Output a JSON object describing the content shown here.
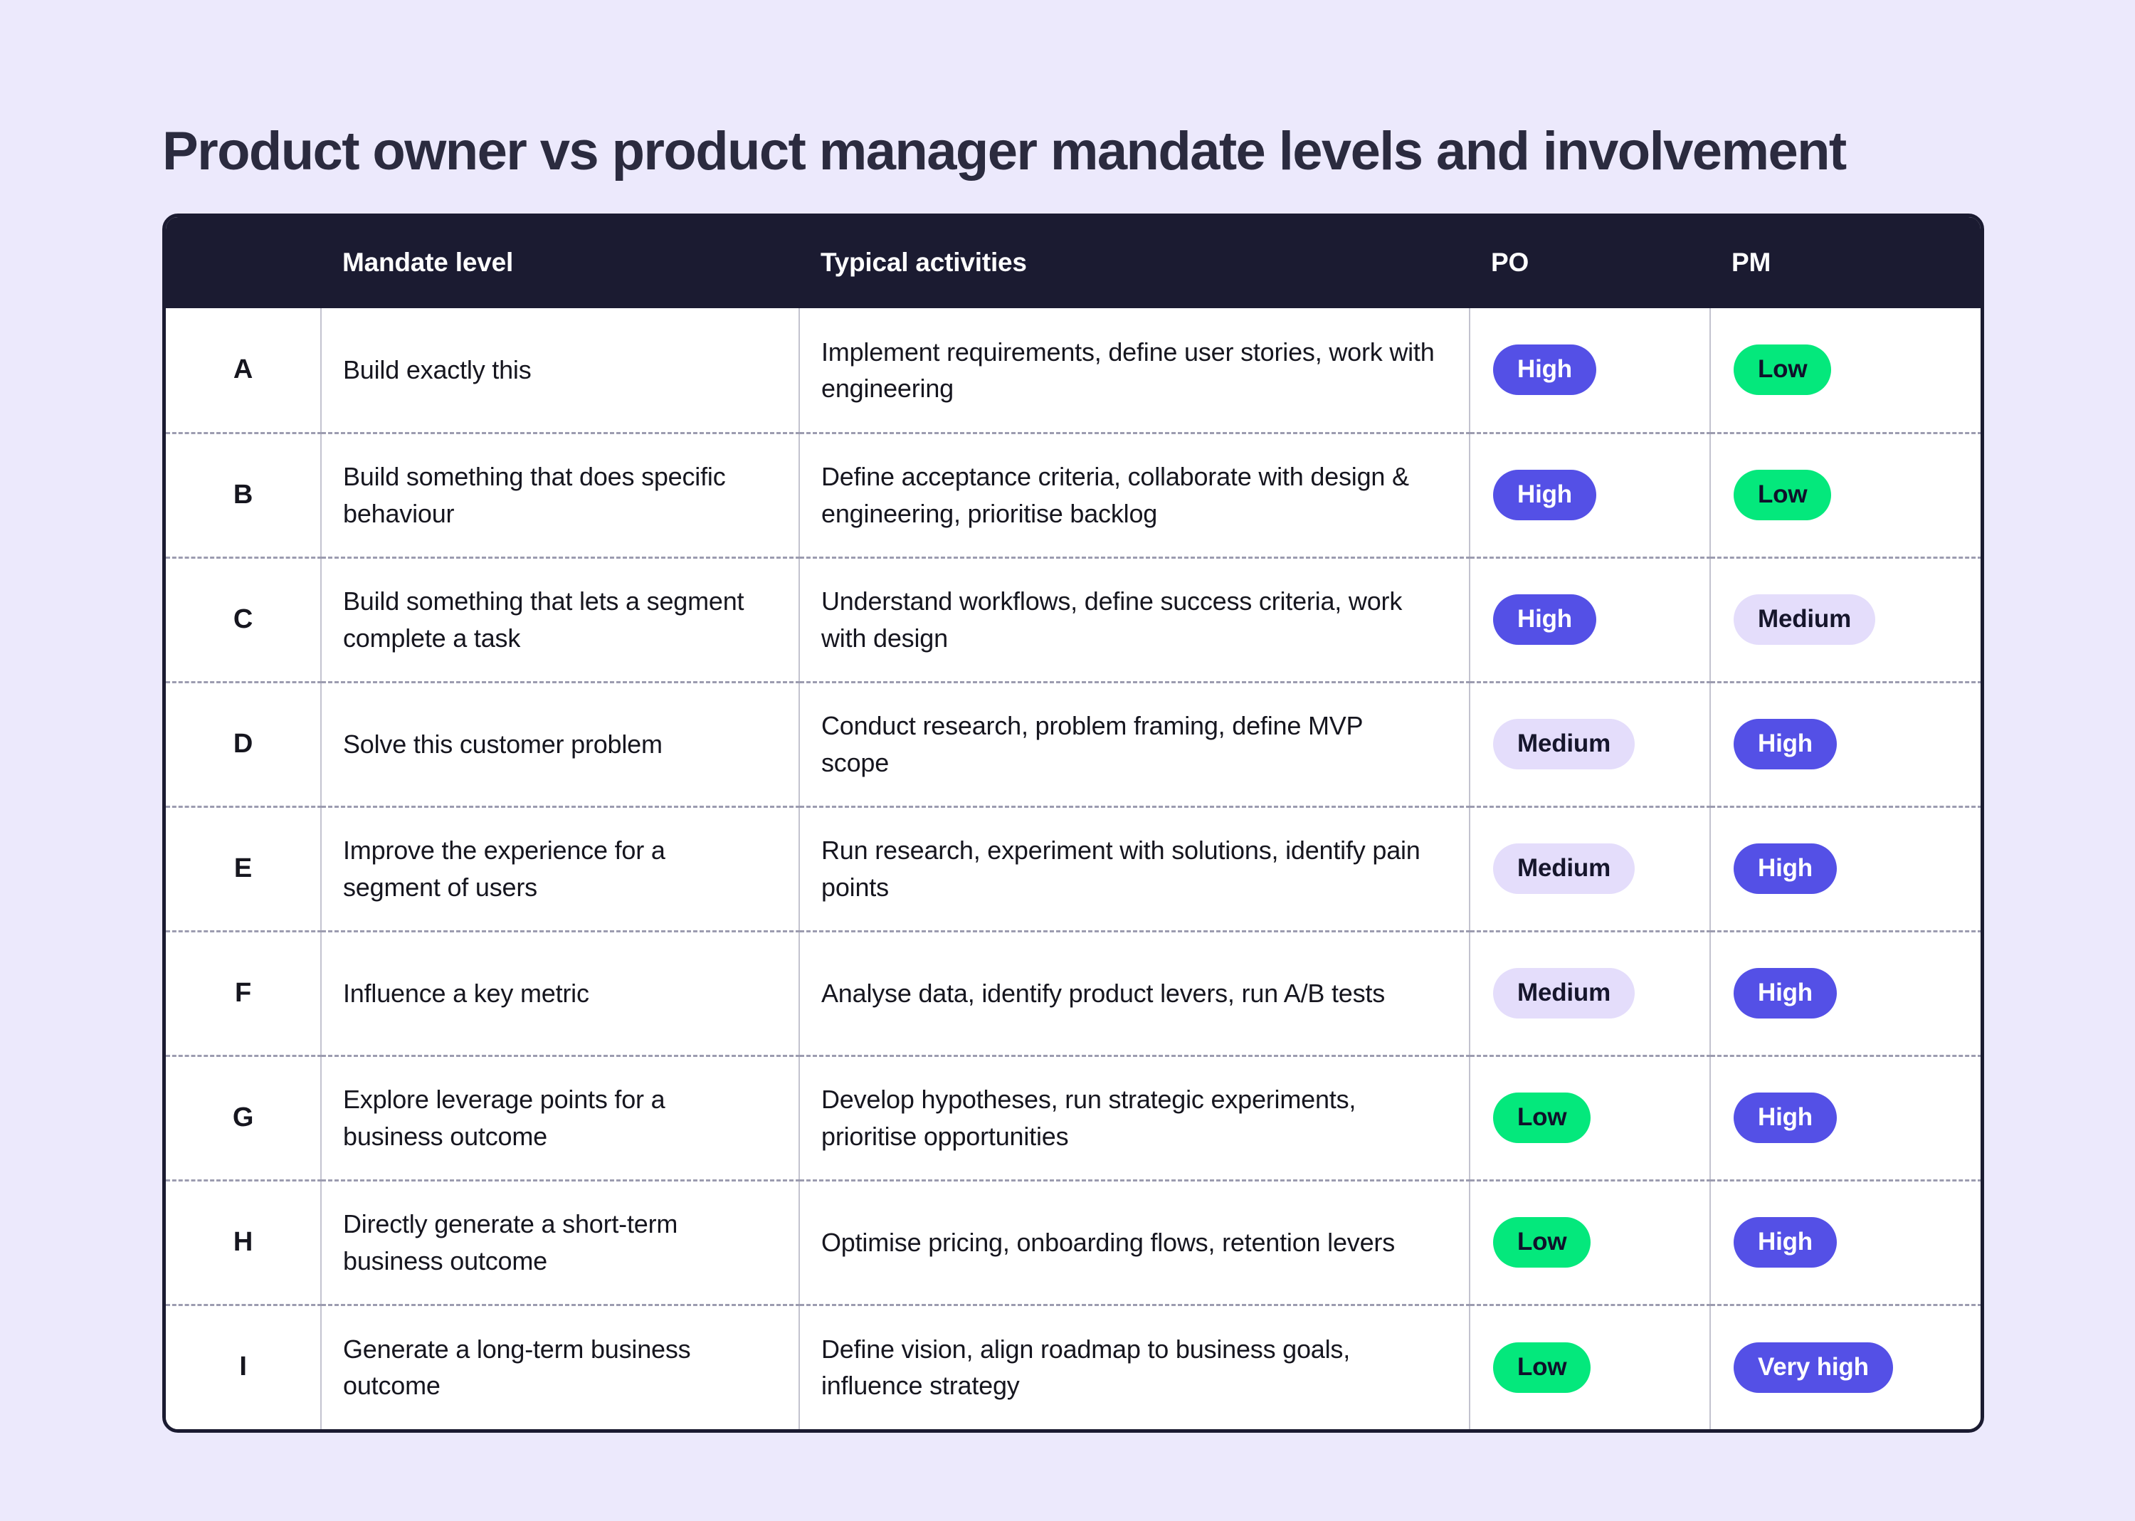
{
  "page": {
    "title": "Product owner vs product manager mandate levels and involvement",
    "background_color": "#ece9fc",
    "title_color": "#2b2b3f"
  },
  "table": {
    "border_color": "#1b1b31",
    "header_background": "#1b1b31",
    "header_text_color": "#ffffff",
    "columns": [
      {
        "key": "letter",
        "label": ""
      },
      {
        "key": "mandate",
        "label": "Mandate level"
      },
      {
        "key": "activities",
        "label": "Typical activities"
      },
      {
        "key": "po",
        "label": "PO"
      },
      {
        "key": "pm",
        "label": "PM"
      }
    ],
    "rows": [
      {
        "letter": "A",
        "mandate": "Build exactly this",
        "activities": "Implement requirements, define user stories, work with engineering",
        "po": "High",
        "pm": "Low"
      },
      {
        "letter": "B",
        "mandate": "Build something that does specific behaviour",
        "activities": "Define acceptance criteria, collaborate with design & engineering, prioritise backlog",
        "po": "High",
        "pm": "Low"
      },
      {
        "letter": "C",
        "mandate": "Build something that lets a segment complete a task",
        "activities": "Understand workflows, define success criteria, work with design",
        "po": "High",
        "pm": "Medium"
      },
      {
        "letter": "D",
        "mandate": "Solve this customer problem",
        "activities": "Conduct research, problem framing, define MVP scope",
        "po": "Medium",
        "pm": "High"
      },
      {
        "letter": "E",
        "mandate": "Improve the experience for a segment of users",
        "activities": "Run research, experiment with solutions, identify pain points",
        "po": "Medium",
        "pm": "High"
      },
      {
        "letter": "F",
        "mandate": "Influence a key metric",
        "activities": "Analyse data, identify product levers, run A/B tests",
        "po": "Medium",
        "pm": "High"
      },
      {
        "letter": "G",
        "mandate": "Explore leverage points for a business outcome",
        "activities": "Develop hypotheses, run strategic experiments, prioritise opportunities",
        "po": "Low",
        "pm": "High"
      },
      {
        "letter": "H",
        "mandate": "Directly generate a short-term business outcome",
        "activities": "Optimise pricing, onboarding flows, retention levers",
        "po": "Low",
        "pm": "High"
      },
      {
        "letter": "I",
        "mandate": "Generate a long-term business outcome",
        "activities": "Define vision, align roadmap to business goals, influence strategy",
        "po": "Low",
        "pm": "Very high"
      }
    ]
  },
  "badge_colors": {
    "high": "#5450e6",
    "very_high": "#5450e6",
    "low": "#04e87c",
    "medium": "#e4ddfb"
  }
}
